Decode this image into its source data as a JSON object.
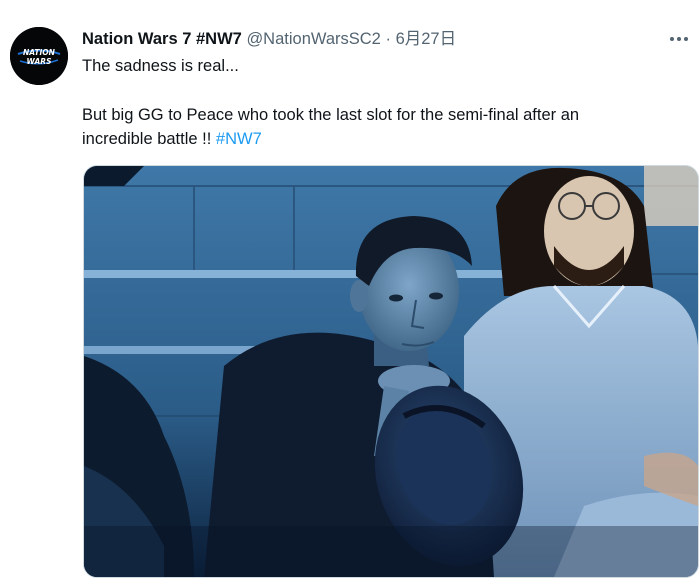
{
  "author": {
    "display_name": "Nation Wars 7 #NW7",
    "handle": "@NationWarsSC2",
    "separator": "·",
    "timestamp": "6月27日",
    "avatar_text_top": "NATION",
    "avatar_text_bottom": "WARS"
  },
  "tweet": {
    "line1": "The sadness is real...",
    "line2": "But big GG to Peace who took the last slot for the semi-final after an",
    "line3_text": "incredible battle !! ",
    "line3_hashtag": "#NW7"
  },
  "icons": {
    "more": "more-dots-icon"
  },
  "colors": {
    "link": "#1d9bf0",
    "secondary_text": "#536471",
    "primary_text": "#0f1419",
    "media_tint": "#1a4a7a"
  }
}
